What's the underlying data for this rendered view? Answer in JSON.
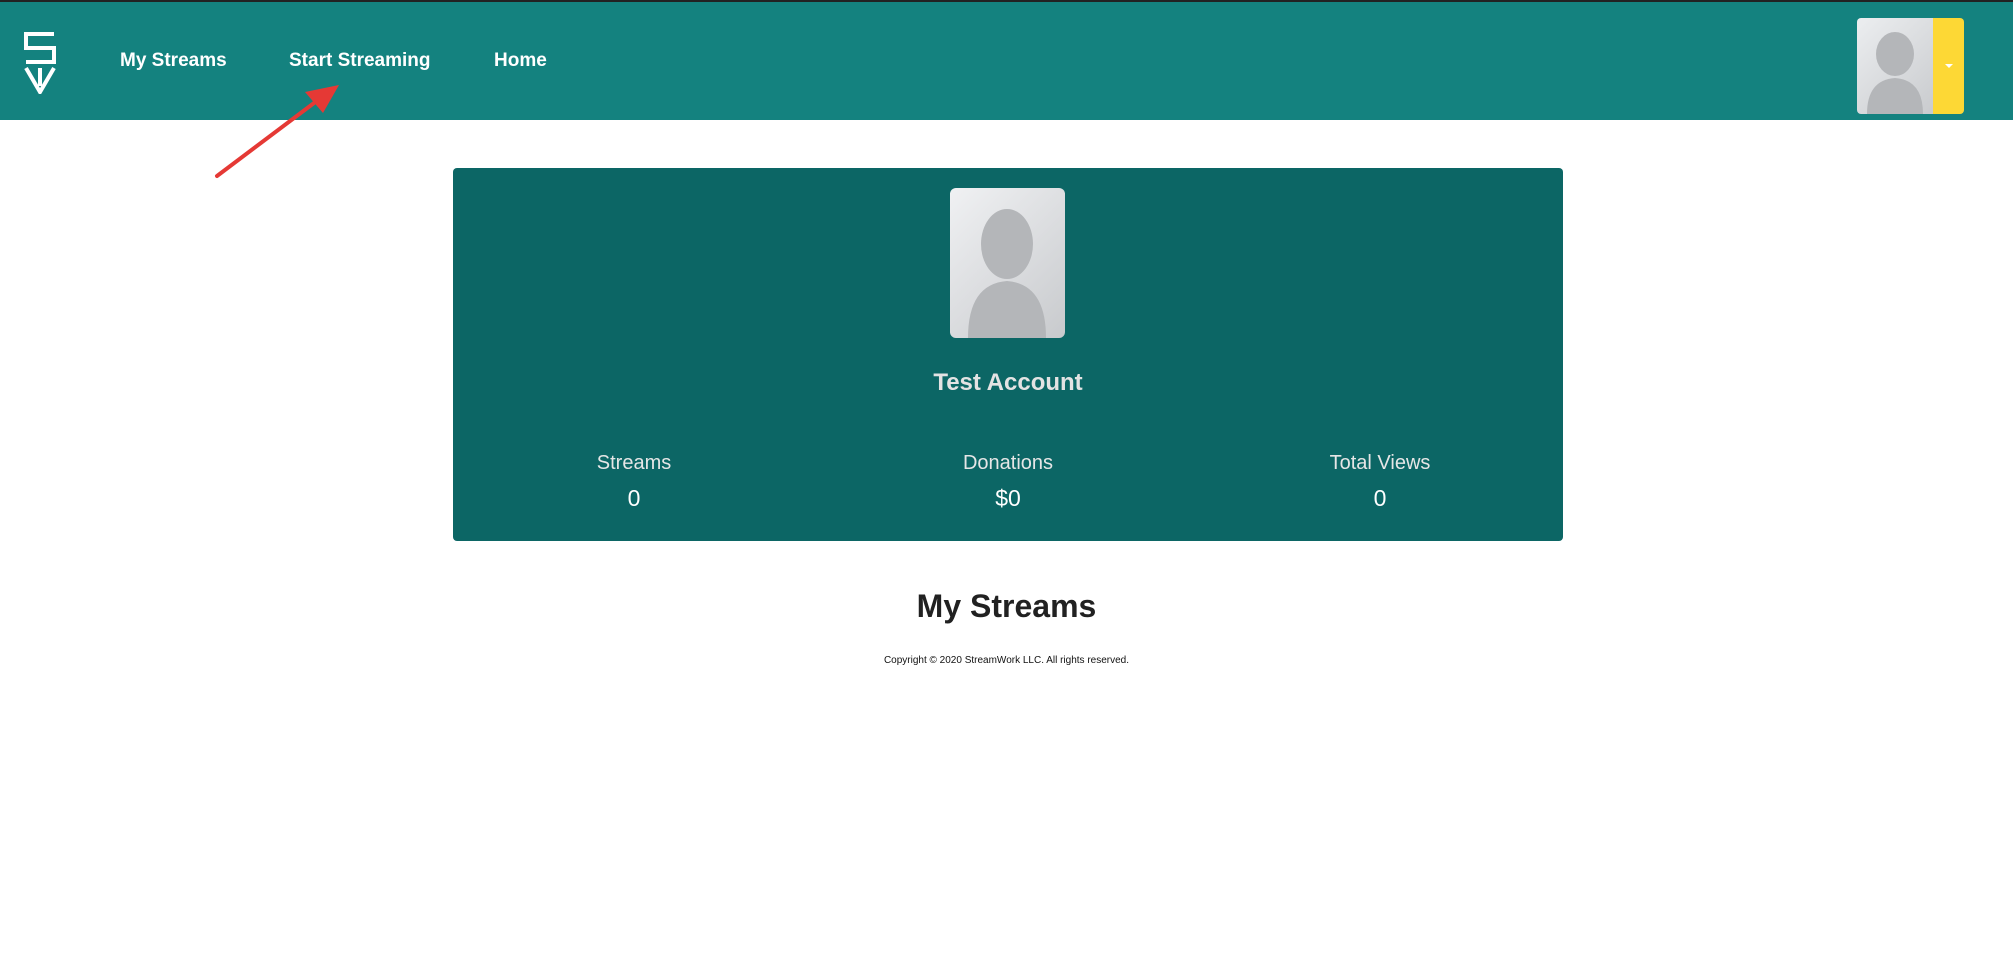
{
  "navbar": {
    "logo_icon": "streamwork-logo-icon",
    "links": {
      "my_streams": "My Streams",
      "start_streaming": "Start Streaming",
      "home": "Home"
    },
    "user_menu": {
      "avatar_icon": "user-silhouette-icon",
      "dropdown_icon": "caret-down-icon"
    },
    "colors": {
      "background": "#14827f",
      "dropdown": "#fdd835"
    }
  },
  "profile": {
    "name": "Test Account",
    "avatar_icon": "user-silhouette-icon",
    "stats": {
      "streams_label": "Streams",
      "streams_value": "0",
      "donations_label": "Donations",
      "donations_value": "$0",
      "views_label": "Total Views",
      "views_value": "0"
    },
    "card_color": "#0c6665"
  },
  "main": {
    "section_title": "My Streams"
  },
  "footer": {
    "copyright": "Copyright © 2020 StreamWork LLC. All rights reserved."
  },
  "annotation": {
    "arrow_color": "#e53935"
  }
}
